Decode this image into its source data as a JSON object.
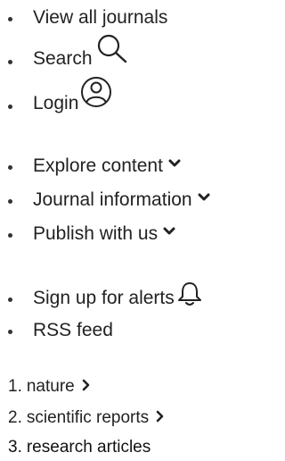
{
  "menu_primary": [
    {
      "label": "View all journals",
      "icon": ""
    },
    {
      "label": "Search",
      "icon": "search-icon"
    },
    {
      "label": "Login",
      "icon": "user-icon"
    }
  ],
  "menu_explore": [
    {
      "label": "Explore content",
      "icon": "chevron-down-icon"
    },
    {
      "label": "Journal information",
      "icon": "chevron-down-icon"
    },
    {
      "label": "Publish with us",
      "icon": "chevron-down-icon"
    }
  ],
  "menu_alerts": [
    {
      "label": "Sign up for alerts",
      "icon": "bell-icon"
    },
    {
      "label": "RSS feed",
      "icon": ""
    }
  ],
  "breadcrumb": [
    {
      "number": "1.",
      "label": "nature"
    },
    {
      "number": "2.",
      "label": "scientific reports"
    },
    {
      "number": "3.",
      "label": "research articles"
    }
  ],
  "colors": {
    "text": "#222222",
    "icon": "#222222"
  }
}
